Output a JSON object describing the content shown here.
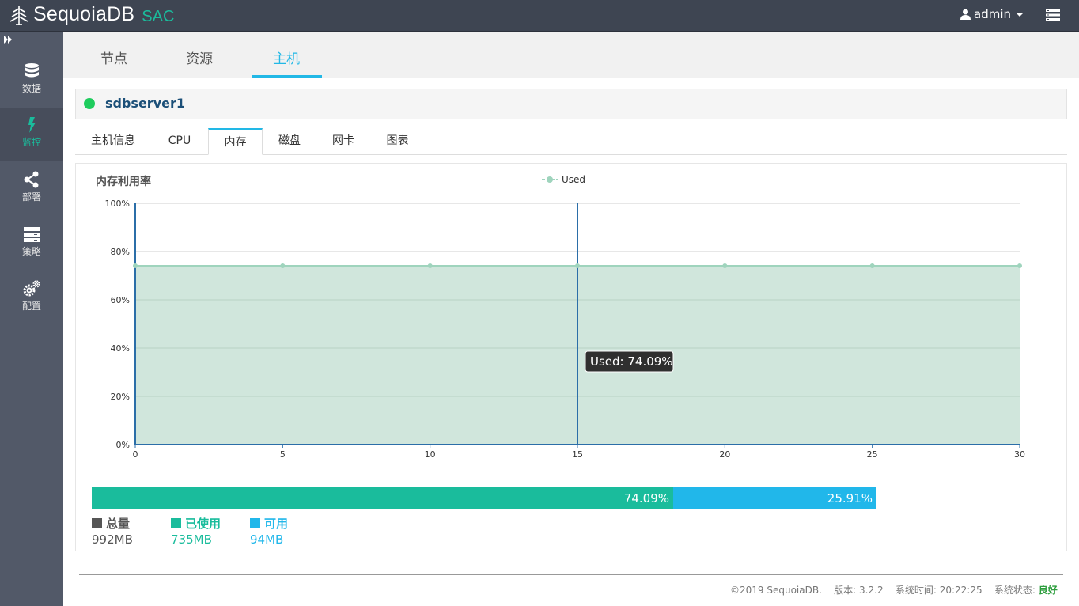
{
  "app": {
    "name": "SequoiaDB",
    "sub": "SAC"
  },
  "user": {
    "name": "admin"
  },
  "sidebar": {
    "items": [
      {
        "label": "数据",
        "icon": "database-icon"
      },
      {
        "label": "监控",
        "icon": "bolt-icon"
      },
      {
        "label": "部署",
        "icon": "share-icon"
      },
      {
        "label": "策略",
        "icon": "server-icon"
      },
      {
        "label": "配置",
        "icon": "gears-icon"
      }
    ],
    "active": "监控"
  },
  "nav": {
    "tabs": [
      "节点",
      "资源",
      "主机"
    ],
    "active": "主机"
  },
  "host": {
    "name": "sdbserver1",
    "status_color": "#1ecc5d"
  },
  "subtabs": {
    "items": [
      "主机信息",
      "CPU",
      "内存",
      "磁盘",
      "网卡",
      "图表"
    ],
    "active": "内存"
  },
  "chart_data": {
    "type": "area",
    "title": "内存利用率",
    "legend": [
      "Used"
    ],
    "x": [
      0,
      5,
      10,
      15,
      20,
      25,
      30
    ],
    "series": [
      {
        "name": "Used",
        "values": [
          74.09,
          74.09,
          74.09,
          74.09,
          74.09,
          74.09,
          74.09
        ]
      }
    ],
    "xticks": [
      "0",
      "5",
      "10",
      "15",
      "20",
      "25",
      "30"
    ],
    "yticks": [
      "0%",
      "20%",
      "40%",
      "60%",
      "80%",
      "100%"
    ],
    "ylim": [
      0,
      100
    ],
    "xlim": [
      0,
      30
    ],
    "tooltip": {
      "x": 15,
      "text": "Used: 74.09%"
    },
    "colors": {
      "line": "#9fd4bd",
      "fill": "#d0e6dc",
      "axis": "#2b6ea8"
    }
  },
  "memory": {
    "used_pct": 74.09,
    "used_pct_label": "74.09%",
    "free_pct_label": "25.91%",
    "total": {
      "label": "总量",
      "value": "992MB",
      "color": "#555555"
    },
    "used": {
      "label": "已使用",
      "value": "735MB",
      "color": "#1abc9c"
    },
    "free": {
      "label": "可用",
      "value": "94MB",
      "color": "#21b7ea"
    }
  },
  "footer": {
    "copyright": "©2019 SequoiaDB.",
    "version_label": "版本:",
    "version": "3.2.2",
    "time_label": "系统时间:",
    "time": "20:22:25",
    "status_label": "系统状态:",
    "status": "良好"
  }
}
